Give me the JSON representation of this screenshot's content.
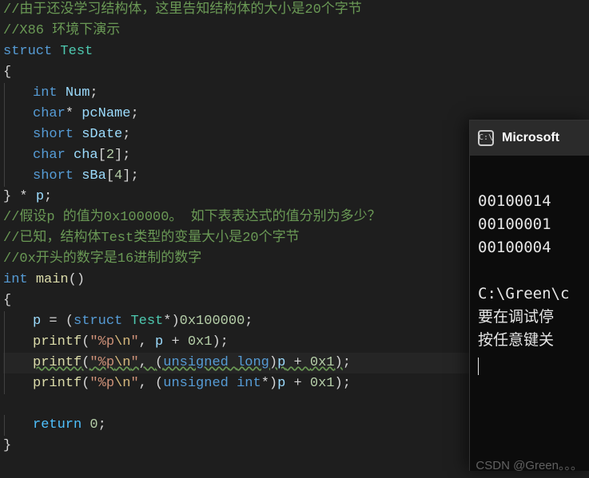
{
  "code": {
    "c1": "//由于还没学习结构体，这里告知结构体的大小是20个字节",
    "c2": "//X86 环境下演示",
    "kw_struct": "struct",
    "type_test": "Test",
    "ob": "{",
    "int": "int",
    "num": "Num",
    "char": "char",
    "star": "*",
    "pcName": "pcName",
    "short": "short",
    "sDate": "sDate",
    "cha": "cha",
    "n2": "2",
    "sBa": "sBa",
    "n4": "4",
    "cb": "}",
    "p": "p",
    "c3": "//假设p 的值为0x100000。 如下表表达式的值分别为多少？",
    "c4": "//已知，结构体Test类型的变量大小是20个字节",
    "c5": "//0x开头的数字是16进制的数字",
    "main": "main",
    "void_paren": "()",
    "eq": " = ",
    "lparen": "(",
    "rparen": ")",
    "addr": "0x100000",
    "semi": ";",
    "printf": "printf",
    "fmt_q1": "\"",
    "fmt_body": "%p",
    "fmt_nl": "\\n",
    "fmt_q2": "\"",
    "comma": ", ",
    "plus": " + ",
    "hex1": "0x1",
    "unsigned": "unsigned",
    "long": "long",
    "intkw": "int",
    "return": "return",
    "zero": "0"
  },
  "terminal": {
    "title": "Microsoft",
    "icon_text": "C:\\",
    "out1": "00100014",
    "out2": "00100001",
    "out3": "00100004",
    "path": "C:\\Green\\c",
    "cn1": "要在调试停",
    "cn2": "按任意键关"
  },
  "watermark": "CSDN @Green。。。"
}
